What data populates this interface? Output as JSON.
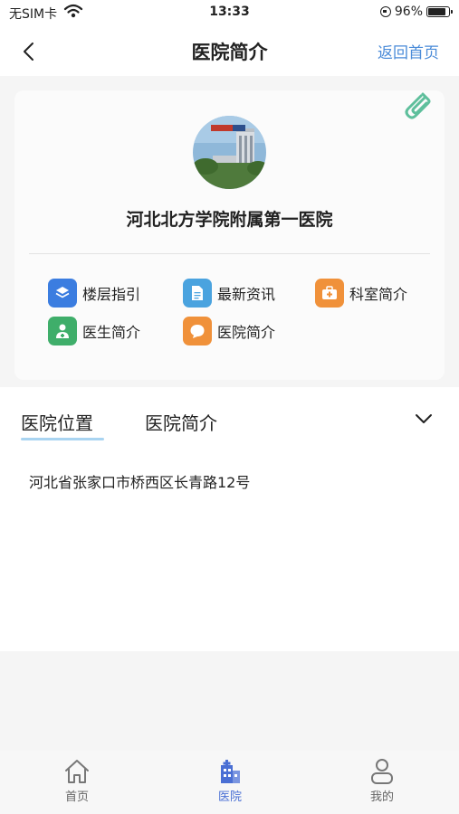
{
  "status_bar": {
    "carrier": "无SIM卡",
    "time": "13:33",
    "battery": "96%",
    "battery_level": 0.96
  },
  "nav": {
    "title": "医院简介",
    "home_link": "返回首页"
  },
  "hospital": {
    "name": "河北北方学院附属第一医院"
  },
  "menu": [
    {
      "label": "楼层指引",
      "icon": "layers-icon",
      "color": "#3b7de0"
    },
    {
      "label": "最新资讯",
      "icon": "document-icon",
      "color": "#4aa3df"
    },
    {
      "label": "科室简介",
      "icon": "medical-kit-icon",
      "color": "#f0913a"
    },
    {
      "label": "医生简介",
      "icon": "doctor-icon",
      "color": "#3fae6a"
    },
    {
      "label": "医院简介",
      "icon": "chat-bubble-icon",
      "color": "#f0913a"
    }
  ],
  "tabs": [
    {
      "label": "医院位置",
      "active": true
    },
    {
      "label": "医院简介",
      "active": false
    }
  ],
  "address": "河北省张家口市桥西区长青路12号",
  "tab_bar": [
    {
      "label": "首页",
      "icon": "home-icon",
      "active": false
    },
    {
      "label": "医院",
      "icon": "hospital-icon",
      "active": true
    },
    {
      "label": "我的",
      "icon": "user-icon",
      "active": false
    }
  ]
}
